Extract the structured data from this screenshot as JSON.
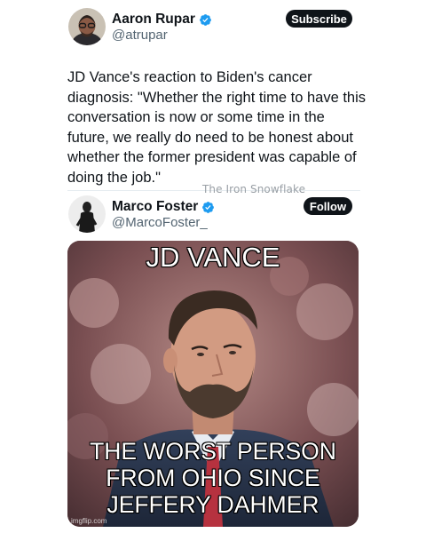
{
  "post1": {
    "display_name": "Aaron Rupar",
    "handle": "@atrupar",
    "action_label": "Subscribe",
    "text": "JD Vance's reaction to Biden's cancer diagnosis: \"Whether the right time to have this conversation is now or some time in the future, we really do need to be honest about whether the former president was capable of doing the job.\""
  },
  "watermark": "The Iron Snowflake",
  "post2": {
    "display_name": "Marco Foster",
    "handle": "@MarcoFoster_",
    "action_label": "Follow",
    "meme": {
      "top_caption": "JD VANCE",
      "bottom_lines": [
        "THE WORST PERSON",
        "FROM OHIO SINCE",
        "JEFFERY DAHMER"
      ],
      "source_mark": "imgflip.com"
    }
  },
  "colors": {
    "verified": "#1d9bf0",
    "button": "#0f1419",
    "text_primary": "#0f1419",
    "text_secondary": "#536471"
  },
  "icons": {
    "verified": "verified-badge-icon"
  }
}
